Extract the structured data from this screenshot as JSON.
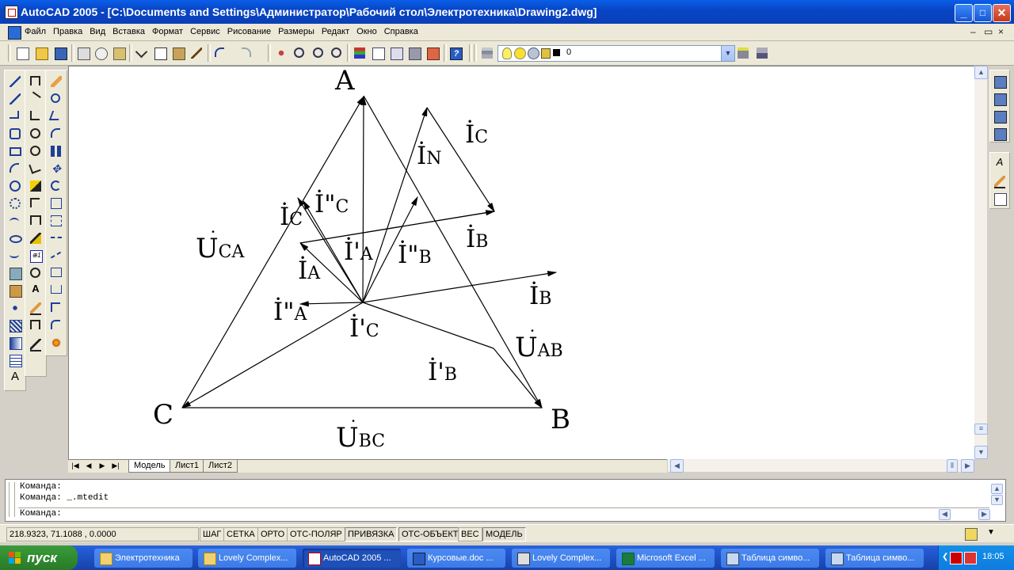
{
  "window": {
    "title": "AutoCAD 2005 - [C:\\Documents and Settings\\Администратор\\Рабочий стол\\Электротехника\\Drawing2.dwg]",
    "buttons": {
      "minimize": "_",
      "maximize": "□",
      "close": "✕"
    }
  },
  "menu": {
    "items": [
      "Файл",
      "Правка",
      "Вид",
      "Вставка",
      "Формат",
      "Сервис",
      "Рисование",
      "Размеры",
      "Редакт",
      "Окно",
      "Справка"
    ],
    "doc_buttons": {
      "minimize": "–",
      "restore": "▭",
      "close": "×"
    }
  },
  "toolbar": {
    "layer_value": "0",
    "layer_dropdown_icon": "chevron-down-icon"
  },
  "drawing": {
    "vertex_labels": {
      "A": "A",
      "B": "B",
      "C": "C"
    },
    "voltage_labels": {
      "uca": {
        "main": "U",
        "sub": "CA"
      },
      "uab": {
        "main": "U",
        "sub": "AB"
      },
      "ubc": {
        "main": "U",
        "sub": "BC"
      }
    },
    "current_labels": {
      "ic_top": {
        "main": "İ",
        "sub": "C"
      },
      "in": {
        "main": "İ",
        "sub": "N"
      },
      "ib_right": {
        "main": "İ",
        "sub": "B"
      },
      "ib_far": {
        "main": "İ",
        "sub": "B"
      },
      "ic_left": {
        "main": "İ",
        "sub": "C"
      },
      "idd_c": {
        "main": "İ\"",
        "sub": "C"
      },
      "id_a": {
        "main": "İ'",
        "sub": "A"
      },
      "idd_b": {
        "main": "İ\"",
        "sub": "B"
      },
      "ia": {
        "main": "İ",
        "sub": "A"
      },
      "idd_a": {
        "main": "İ\"",
        "sub": "A"
      },
      "id_c": {
        "main": "İ'",
        "sub": "C"
      },
      "id_b": {
        "main": "İ'",
        "sub": "B"
      }
    }
  },
  "tabs": [
    "Модель",
    "Лист1",
    "Лист2"
  ],
  "active_tab": "Модель",
  "command": {
    "lines": [
      "Команда:",
      "Команда: _.mtedit"
    ],
    "prompt": "Команда:"
  },
  "status": {
    "coords": "218.9323, 71.1088 , 0.0000",
    "toggles": [
      "ШАГ",
      "СЕТКА",
      "ОРТО",
      "ОТС-ПОЛЯР",
      "ПРИВЯЗКА",
      "ОТС-ОБЪЕКТ",
      "ВЕС",
      "МОДЕЛЬ"
    ],
    "on_toggles": [
      "ПРИВЯЗКА",
      "ОТС-ОБЪЕКТ",
      "МОДЕЛЬ"
    ]
  },
  "taskbar": {
    "start": "пуск",
    "tasks": [
      {
        "label": "Электротехника",
        "icon": "folder-icon"
      },
      {
        "label": "Lovely Complex...",
        "icon": "folder-icon"
      },
      {
        "label": "AutoCAD 2005 ...",
        "icon": "autocad-icon"
      },
      {
        "label": "Курсовые.doc ...",
        "icon": "word-icon"
      },
      {
        "label": "Lovely Complex...",
        "icon": "media-icon"
      },
      {
        "label": "Microsoft Excel ...",
        "icon": "excel-icon"
      },
      {
        "label": "Таблица симво...",
        "icon": "charmap-icon"
      },
      {
        "label": "Таблица симво...",
        "icon": "charmap-icon"
      }
    ],
    "active_task": "AutoCAD 2005 ...",
    "clock": "18:05"
  },
  "colors": {
    "titlebar": "#0a5ee8",
    "taskbar": "#245edb",
    "start": "#3c9a3c",
    "canvas": "#ffffff"
  }
}
